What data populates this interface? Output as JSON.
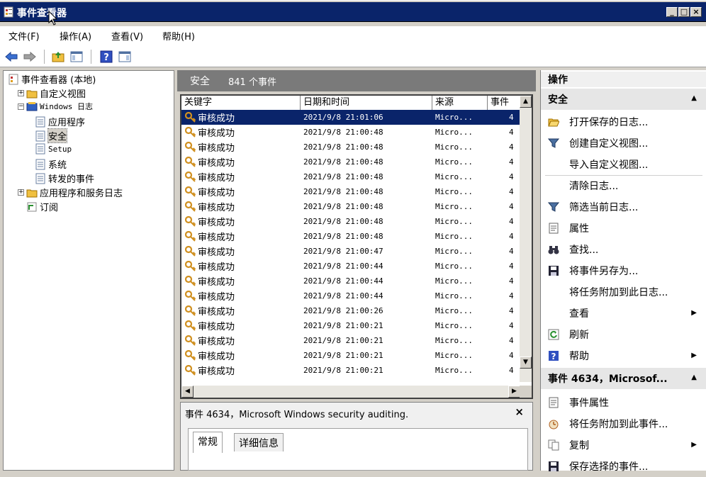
{
  "window": {
    "title": "事件查看器"
  },
  "title_buttons": [
    "_",
    "□",
    "×"
  ],
  "menu": [
    "文件(F)",
    "操作(A)",
    "查看(V)",
    "帮助(H)"
  ],
  "tree": [
    {
      "label": "事件查看器 (本地)",
      "indent": 0,
      "expander": ""
    },
    {
      "label": "自定义视图",
      "indent": 1,
      "expander": "+"
    },
    {
      "label": "Windows 日志",
      "indent": 1,
      "expander": "-"
    },
    {
      "label": "应用程序",
      "indent": 2,
      "expander": ""
    },
    {
      "label": "安全",
      "indent": 2,
      "expander": "",
      "selected": true
    },
    {
      "label": "Setup",
      "indent": 2,
      "expander": ""
    },
    {
      "label": "系统",
      "indent": 2,
      "expander": ""
    },
    {
      "label": "转发的事件",
      "indent": 2,
      "expander": ""
    },
    {
      "label": "应用程序和服务日志",
      "indent": 1,
      "expander": "+"
    },
    {
      "label": "订阅",
      "indent": 1,
      "expander": ""
    }
  ],
  "center": {
    "title": "安全",
    "count": "841 个事件"
  },
  "columns": [
    "关键字",
    "日期和时间",
    "来源",
    "事件"
  ],
  "rows": [
    {
      "keyword": "审核成功",
      "date": "2021/9/8 21:01:06",
      "source": "Micro...",
      "id": "4",
      "selected": true
    },
    {
      "keyword": "审核成功",
      "date": "2021/9/8 21:00:48",
      "source": "Micro...",
      "id": "4"
    },
    {
      "keyword": "审核成功",
      "date": "2021/9/8 21:00:48",
      "source": "Micro...",
      "id": "4"
    },
    {
      "keyword": "审核成功",
      "date": "2021/9/8 21:00:48",
      "source": "Micro...",
      "id": "4"
    },
    {
      "keyword": "审核成功",
      "date": "2021/9/8 21:00:48",
      "source": "Micro...",
      "id": "4"
    },
    {
      "keyword": "审核成功",
      "date": "2021/9/8 21:00:48",
      "source": "Micro...",
      "id": "4"
    },
    {
      "keyword": "审核成功",
      "date": "2021/9/8 21:00:48",
      "source": "Micro...",
      "id": "4"
    },
    {
      "keyword": "审核成功",
      "date": "2021/9/8 21:00:48",
      "source": "Micro...",
      "id": "4"
    },
    {
      "keyword": "审核成功",
      "date": "2021/9/8 21:00:48",
      "source": "Micro...",
      "id": "4"
    },
    {
      "keyword": "审核成功",
      "date": "2021/9/8 21:00:47",
      "source": "Micro...",
      "id": "4"
    },
    {
      "keyword": "审核成功",
      "date": "2021/9/8 21:00:44",
      "source": "Micro...",
      "id": "4"
    },
    {
      "keyword": "审核成功",
      "date": "2021/9/8 21:00:44",
      "source": "Micro...",
      "id": "4"
    },
    {
      "keyword": "审核成功",
      "date": "2021/9/8 21:00:44",
      "source": "Micro...",
      "id": "4"
    },
    {
      "keyword": "审核成功",
      "date": "2021/9/8 21:00:26",
      "source": "Micro...",
      "id": "4"
    },
    {
      "keyword": "审核成功",
      "date": "2021/9/8 21:00:21",
      "source": "Micro...",
      "id": "4"
    },
    {
      "keyword": "审核成功",
      "date": "2021/9/8 21:00:21",
      "source": "Micro...",
      "id": "4"
    },
    {
      "keyword": "审核成功",
      "date": "2021/9/8 21:00:21",
      "source": "Micro...",
      "id": "4"
    },
    {
      "keyword": "审核成功",
      "date": "2021/9/8 21:00:21",
      "source": "Micro...",
      "id": "4"
    }
  ],
  "detail": {
    "title": "事件 4634，Microsoft Windows security auditing.",
    "close": "×",
    "tabs": [
      "常规",
      "详细信息"
    ]
  },
  "actions": {
    "header": "操作",
    "section1": "安全",
    "items1": [
      {
        "label": "打开保存的日志...",
        "icon": "folder-open-icon"
      },
      {
        "label": "创建自定义视图...",
        "icon": "filter-icon"
      },
      {
        "label": "导入自定义视图...",
        "icon": ""
      },
      {
        "label": "清除日志...",
        "icon": ""
      },
      {
        "label": "筛选当前日志...",
        "icon": "filter-icon"
      },
      {
        "label": "属性",
        "icon": "properties-icon"
      },
      {
        "label": "查找...",
        "icon": "binoculars-icon"
      },
      {
        "label": "将事件另存为...",
        "icon": "save-icon"
      },
      {
        "label": "将任务附加到此日志...",
        "icon": ""
      },
      {
        "label": "查看",
        "icon": "",
        "submenu": true
      },
      {
        "label": "刷新",
        "icon": "refresh-icon"
      },
      {
        "label": "帮助",
        "icon": "help-icon",
        "submenu": true
      }
    ],
    "section2": "事件 4634，Microsof...",
    "items2": [
      {
        "label": "事件属性",
        "icon": "properties-icon"
      },
      {
        "label": "将任务附加到此事件...",
        "icon": "task-icon"
      },
      {
        "label": "复制",
        "icon": "copy-icon",
        "submenu": true
      },
      {
        "label": "保存选择的事件...",
        "icon": "save-icon"
      }
    ]
  },
  "colors": {
    "titlebar": "#0a246a",
    "selection": "#0a246a",
    "panel_head": "#7a7a7a"
  }
}
